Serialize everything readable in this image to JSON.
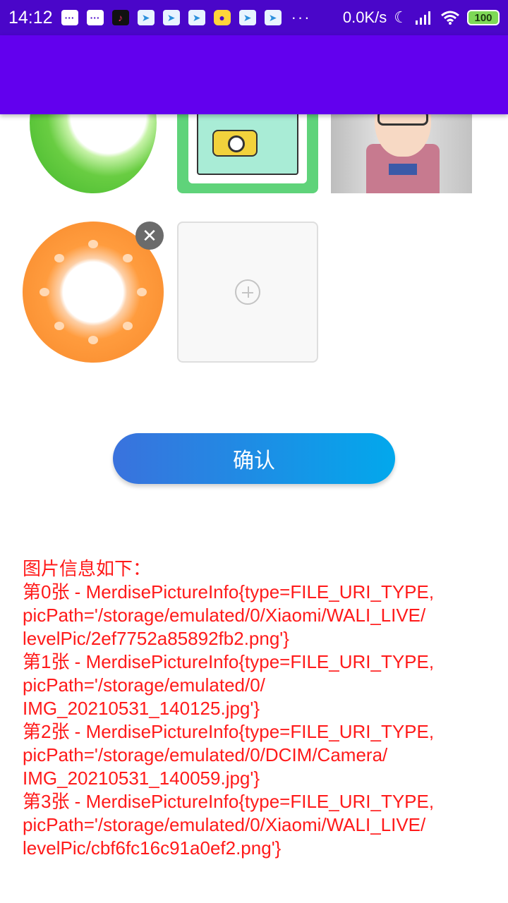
{
  "status_bar": {
    "time": "14:12",
    "dots": "···",
    "net_speed": "0.0K/s",
    "battery": "100"
  },
  "confirm_button": {
    "label": "确认"
  },
  "picture_info": {
    "header": "图片信息如下：",
    "lines": [
      "第0张 - MerdisePictureInfo{type=FILE_URI_TYPE,",
      "picPath='/storage/emulated/0/Xiaomi/WALI_LIVE/",
      "levelPic/2ef7752a85892fb2.png'}",
      "第1张 - MerdisePictureInfo{type=FILE_URI_TYPE,",
      "picPath='/storage/emulated/0/",
      "IMG_20210531_140125.jpg'}",
      "第2张 - MerdisePictureInfo{type=FILE_URI_TYPE,",
      "picPath='/storage/emulated/0/DCIM/Camera/",
      "IMG_20210531_140059.jpg'}",
      "第3张 - MerdisePictureInfo{type=FILE_URI_TYPE,",
      "picPath='/storage/emulated/0/Xiaomi/WALI_LIVE/",
      "levelPic/cbf6fc16c91a0ef2.png'}"
    ]
  },
  "colors": {
    "status_bar": "#4a06c9",
    "app_bar": "#6200ee",
    "info_text": "#ff1a1a",
    "button_gradient_start": "#3a72dd",
    "button_gradient_end": "#02a8ec"
  }
}
